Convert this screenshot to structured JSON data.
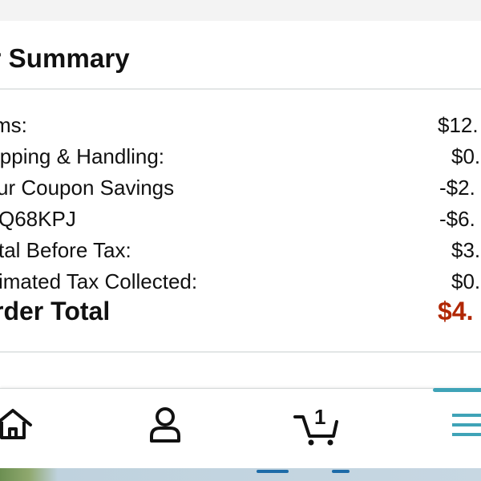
{
  "summary": {
    "title": "er Summary",
    "rows": [
      {
        "label": "ms:",
        "value": "$12."
      },
      {
        "label": "ipping & Handling:",
        "value": "$0."
      },
      {
        "label": "ur Coupon Savings",
        "value": "-$2."
      },
      {
        "label": "Q68KPJ",
        "value": "-$6."
      },
      {
        "label": "tal Before Tax:",
        "value": "$3."
      },
      {
        "label": "imated Tax Collected:",
        "value": "$0."
      }
    ],
    "total": {
      "label": "rder Total",
      "value": "$4."
    }
  },
  "nav": {
    "cart_count": "1",
    "items": [
      "home-icon",
      "account-icon",
      "cart-icon",
      "menu-icon"
    ]
  },
  "colors": {
    "total_value": "#b12704",
    "nav_accent": "#3fa3b7"
  }
}
